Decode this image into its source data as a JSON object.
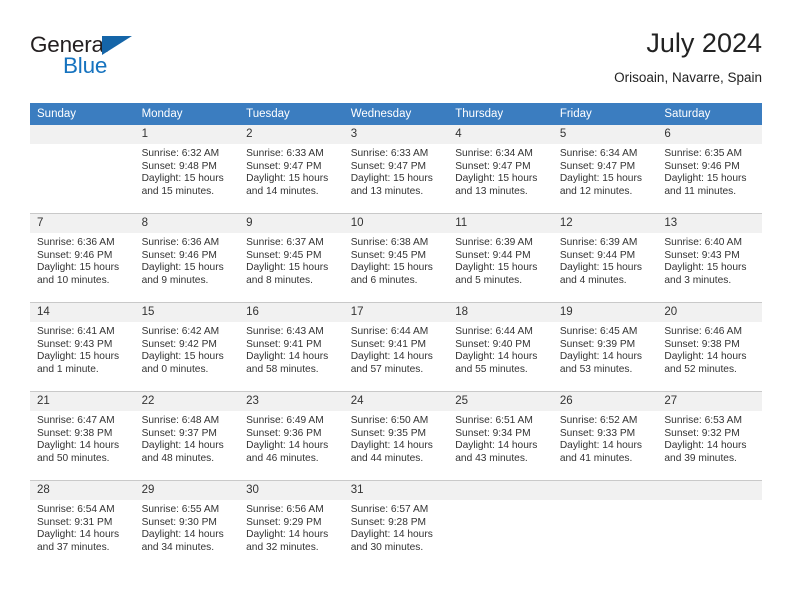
{
  "brand": {
    "name_part1": "General",
    "name_part2": "Blue",
    "triangle_color": "#1565a8",
    "blue_text_color": "#1673bf"
  },
  "header": {
    "title": "July 2024",
    "location": "Orisoain, Navarre, Spain"
  },
  "colors": {
    "header_band": "#3b7dc0",
    "daynum_band": "#f1f1f1",
    "grid_line": "#c9c9c9"
  },
  "weekday_headers": [
    "Sunday",
    "Monday",
    "Tuesday",
    "Wednesday",
    "Thursday",
    "Friday",
    "Saturday"
  ],
  "labels": {
    "sunrise_prefix": "Sunrise:",
    "sunset_prefix": "Sunset:",
    "daylight_prefix": "Daylight:"
  },
  "weeks": [
    [
      {
        "day": "",
        "sunrise": "",
        "sunset": "",
        "daylight_line1": "",
        "daylight_line2": "",
        "empty": true
      },
      {
        "day": "1",
        "sunrise": "Sunrise: 6:32 AM",
        "sunset": "Sunset: 9:48 PM",
        "daylight_line1": "Daylight: 15 hours",
        "daylight_line2": "and 15 minutes."
      },
      {
        "day": "2",
        "sunrise": "Sunrise: 6:33 AM",
        "sunset": "Sunset: 9:47 PM",
        "daylight_line1": "Daylight: 15 hours",
        "daylight_line2": "and 14 minutes."
      },
      {
        "day": "3",
        "sunrise": "Sunrise: 6:33 AM",
        "sunset": "Sunset: 9:47 PM",
        "daylight_line1": "Daylight: 15 hours",
        "daylight_line2": "and 13 minutes."
      },
      {
        "day": "4",
        "sunrise": "Sunrise: 6:34 AM",
        "sunset": "Sunset: 9:47 PM",
        "daylight_line1": "Daylight: 15 hours",
        "daylight_line2": "and 13 minutes."
      },
      {
        "day": "5",
        "sunrise": "Sunrise: 6:34 AM",
        "sunset": "Sunset: 9:47 PM",
        "daylight_line1": "Daylight: 15 hours",
        "daylight_line2": "and 12 minutes."
      },
      {
        "day": "6",
        "sunrise": "Sunrise: 6:35 AM",
        "sunset": "Sunset: 9:46 PM",
        "daylight_line1": "Daylight: 15 hours",
        "daylight_line2": "and 11 minutes."
      }
    ],
    [
      {
        "day": "7",
        "sunrise": "Sunrise: 6:36 AM",
        "sunset": "Sunset: 9:46 PM",
        "daylight_line1": "Daylight: 15 hours",
        "daylight_line2": "and 10 minutes."
      },
      {
        "day": "8",
        "sunrise": "Sunrise: 6:36 AM",
        "sunset": "Sunset: 9:46 PM",
        "daylight_line1": "Daylight: 15 hours",
        "daylight_line2": "and 9 minutes."
      },
      {
        "day": "9",
        "sunrise": "Sunrise: 6:37 AM",
        "sunset": "Sunset: 9:45 PM",
        "daylight_line1": "Daylight: 15 hours",
        "daylight_line2": "and 8 minutes."
      },
      {
        "day": "10",
        "sunrise": "Sunrise: 6:38 AM",
        "sunset": "Sunset: 9:45 PM",
        "daylight_line1": "Daylight: 15 hours",
        "daylight_line2": "and 6 minutes."
      },
      {
        "day": "11",
        "sunrise": "Sunrise: 6:39 AM",
        "sunset": "Sunset: 9:44 PM",
        "daylight_line1": "Daylight: 15 hours",
        "daylight_line2": "and 5 minutes."
      },
      {
        "day": "12",
        "sunrise": "Sunrise: 6:39 AM",
        "sunset": "Sunset: 9:44 PM",
        "daylight_line1": "Daylight: 15 hours",
        "daylight_line2": "and 4 minutes."
      },
      {
        "day": "13",
        "sunrise": "Sunrise: 6:40 AM",
        "sunset": "Sunset: 9:43 PM",
        "daylight_line1": "Daylight: 15 hours",
        "daylight_line2": "and 3 minutes."
      }
    ],
    [
      {
        "day": "14",
        "sunrise": "Sunrise: 6:41 AM",
        "sunset": "Sunset: 9:43 PM",
        "daylight_line1": "Daylight: 15 hours",
        "daylight_line2": "and 1 minute."
      },
      {
        "day": "15",
        "sunrise": "Sunrise: 6:42 AM",
        "sunset": "Sunset: 9:42 PM",
        "daylight_line1": "Daylight: 15 hours",
        "daylight_line2": "and 0 minutes."
      },
      {
        "day": "16",
        "sunrise": "Sunrise: 6:43 AM",
        "sunset": "Sunset: 9:41 PM",
        "daylight_line1": "Daylight: 14 hours",
        "daylight_line2": "and 58 minutes."
      },
      {
        "day": "17",
        "sunrise": "Sunrise: 6:44 AM",
        "sunset": "Sunset: 9:41 PM",
        "daylight_line1": "Daylight: 14 hours",
        "daylight_line2": "and 57 minutes."
      },
      {
        "day": "18",
        "sunrise": "Sunrise: 6:44 AM",
        "sunset": "Sunset: 9:40 PM",
        "daylight_line1": "Daylight: 14 hours",
        "daylight_line2": "and 55 minutes."
      },
      {
        "day": "19",
        "sunrise": "Sunrise: 6:45 AM",
        "sunset": "Sunset: 9:39 PM",
        "daylight_line1": "Daylight: 14 hours",
        "daylight_line2": "and 53 minutes."
      },
      {
        "day": "20",
        "sunrise": "Sunrise: 6:46 AM",
        "sunset": "Sunset: 9:38 PM",
        "daylight_line1": "Daylight: 14 hours",
        "daylight_line2": "and 52 minutes."
      }
    ],
    [
      {
        "day": "21",
        "sunrise": "Sunrise: 6:47 AM",
        "sunset": "Sunset: 9:38 PM",
        "daylight_line1": "Daylight: 14 hours",
        "daylight_line2": "and 50 minutes."
      },
      {
        "day": "22",
        "sunrise": "Sunrise: 6:48 AM",
        "sunset": "Sunset: 9:37 PM",
        "daylight_line1": "Daylight: 14 hours",
        "daylight_line2": "and 48 minutes."
      },
      {
        "day": "23",
        "sunrise": "Sunrise: 6:49 AM",
        "sunset": "Sunset: 9:36 PM",
        "daylight_line1": "Daylight: 14 hours",
        "daylight_line2": "and 46 minutes."
      },
      {
        "day": "24",
        "sunrise": "Sunrise: 6:50 AM",
        "sunset": "Sunset: 9:35 PM",
        "daylight_line1": "Daylight: 14 hours",
        "daylight_line2": "and 44 minutes."
      },
      {
        "day": "25",
        "sunrise": "Sunrise: 6:51 AM",
        "sunset": "Sunset: 9:34 PM",
        "daylight_line1": "Daylight: 14 hours",
        "daylight_line2": "and 43 minutes."
      },
      {
        "day": "26",
        "sunrise": "Sunrise: 6:52 AM",
        "sunset": "Sunset: 9:33 PM",
        "daylight_line1": "Daylight: 14 hours",
        "daylight_line2": "and 41 minutes."
      },
      {
        "day": "27",
        "sunrise": "Sunrise: 6:53 AM",
        "sunset": "Sunset: 9:32 PM",
        "daylight_line1": "Daylight: 14 hours",
        "daylight_line2": "and 39 minutes."
      }
    ],
    [
      {
        "day": "28",
        "sunrise": "Sunrise: 6:54 AM",
        "sunset": "Sunset: 9:31 PM",
        "daylight_line1": "Daylight: 14 hours",
        "daylight_line2": "and 37 minutes."
      },
      {
        "day": "29",
        "sunrise": "Sunrise: 6:55 AM",
        "sunset": "Sunset: 9:30 PM",
        "daylight_line1": "Daylight: 14 hours",
        "daylight_line2": "and 34 minutes."
      },
      {
        "day": "30",
        "sunrise": "Sunrise: 6:56 AM",
        "sunset": "Sunset: 9:29 PM",
        "daylight_line1": "Daylight: 14 hours",
        "daylight_line2": "and 32 minutes."
      },
      {
        "day": "31",
        "sunrise": "Sunrise: 6:57 AM",
        "sunset": "Sunset: 9:28 PM",
        "daylight_line1": "Daylight: 14 hours",
        "daylight_line2": "and 30 minutes."
      },
      {
        "day": "",
        "sunrise": "",
        "sunset": "",
        "daylight_line1": "",
        "daylight_line2": "",
        "empty": true
      },
      {
        "day": "",
        "sunrise": "",
        "sunset": "",
        "daylight_line1": "",
        "daylight_line2": "",
        "empty": true
      },
      {
        "day": "",
        "sunrise": "",
        "sunset": "",
        "daylight_line1": "",
        "daylight_line2": "",
        "empty": true
      }
    ]
  ]
}
